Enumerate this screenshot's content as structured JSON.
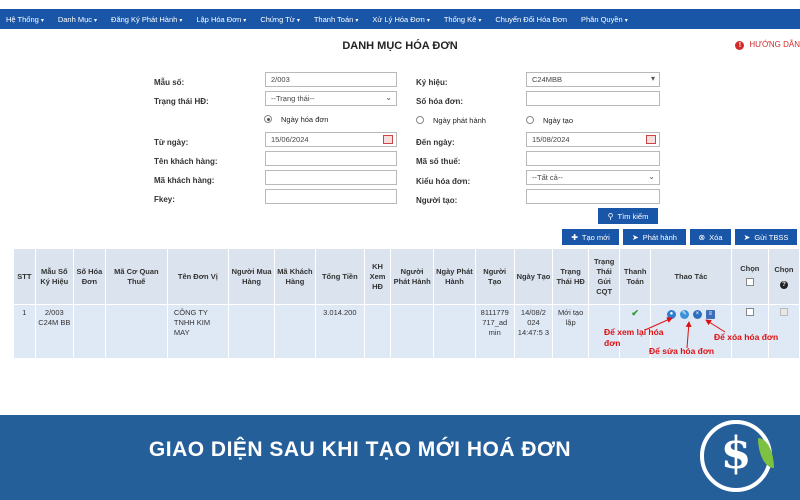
{
  "nav": {
    "items": [
      "Hệ Thống",
      "Danh Mục",
      "Đăng Ký Phát Hành",
      "Lập Hóa Đơn",
      "Chứng Từ",
      "Thanh Toán",
      "Xử Lý Hóa Đơn",
      "Thống Kê",
      "Chuyển Đổi Hóa Đơn",
      "Phân Quyền"
    ],
    "caret": "▾"
  },
  "page_title": "DANH MỤC HÓA ĐƠN",
  "help_label": "HƯỚNG DẪN",
  "form": {
    "mau_so_label": "Mẫu số:",
    "mau_so_value": "2/003",
    "ky_hieu_label": "Ký hiệu:",
    "ky_hieu_value": "C24MBB",
    "trang_thai_label": "Trạng thái HĐ:",
    "trang_thai_value": "--Trạng thái--",
    "so_hoa_don_label": "Số hóa đơn:",
    "so_hoa_don_value": "",
    "radio_ngay_hoa_don": "Ngày hóa đơn",
    "radio_ngay_phat_hanh": "Ngày phát hành",
    "radio_ngay_tao": "Ngày tạo",
    "tu_ngay_label": "Từ ngày:",
    "tu_ngay_value": "15/06/2024",
    "den_ngay_label": "Đến ngày:",
    "den_ngay_value": "15/08/2024",
    "ten_khach_hang_label": "Tên khách hàng:",
    "ma_so_thue_label": "Mã số thuế:",
    "ma_khach_hang_label": "Mã khách hàng:",
    "kieu_hoa_don_label": "Kiểu hóa đơn:",
    "kieu_hoa_don_value": "--Tất cả--",
    "fkey_label": "Fkey:",
    "nguoi_tao_label": "Người tạo:",
    "search_button": "Tìm kiếm"
  },
  "toolbar": {
    "tao_moi": "Tạo mới",
    "phat_hanh": "Phát hành",
    "xoa": "Xóa",
    "gui_tbss": "Gửi TBSS"
  },
  "table": {
    "headers": [
      "STT",
      "Mẫu Số Ký Hiệu",
      "Số Hóa Đơn",
      "Mã Cơ Quan Thuế",
      "Tên Đơn Vị",
      "Người Mua Hàng",
      "Mã Khách Hàng",
      "Tổng Tiền",
      "KH Xem HĐ",
      "Người Phát Hành",
      "Ngày Phát Hành",
      "Người Tạo",
      "Ngày Tạo",
      "Trạng Thái HĐ",
      "Trạng Thái Gửi CQT",
      "Thanh Toán",
      "Thao Tác",
      "Chọn",
      "Chọn"
    ],
    "row": {
      "stt": "1",
      "mau_so": "2/003 C24M BB",
      "ten_don_vi": "CÔNG TY TNHH KIM MAY",
      "tong_tien": "3.014.200",
      "nguoi_tao": "8111779 717_ad min",
      "ngay_tao": "14/08/2 024 14:47:5 3",
      "trang_thai_hd": "Mới tạo lập"
    }
  },
  "annotations": {
    "xem": "Để xem lại hóa đơn",
    "sua": "Để sửa hóa đơn",
    "xoa": "Để xóa hóa đơn"
  },
  "banner_text": "GIAO DIỆN SAU KHI TẠO MỚI HOÁ ĐƠN",
  "colors": {
    "nav": "#1a56a8",
    "banner": "#255f9a",
    "annotation": "#d11111"
  }
}
